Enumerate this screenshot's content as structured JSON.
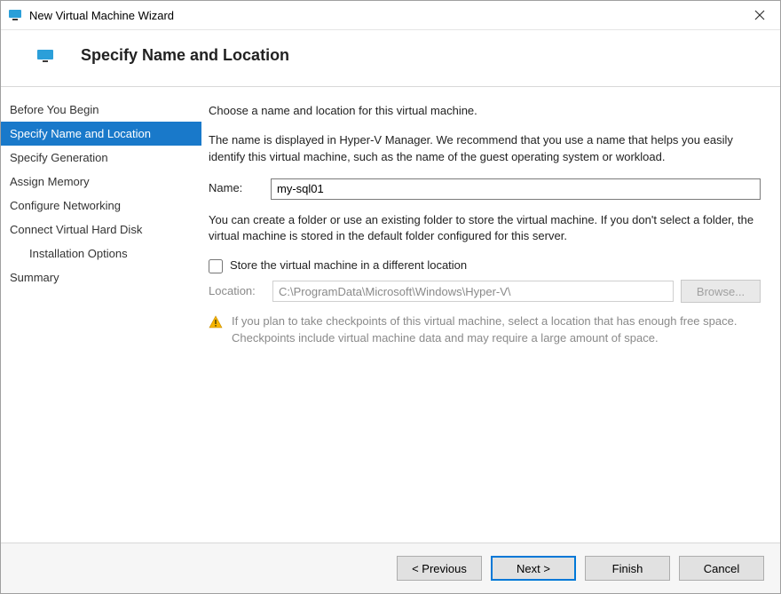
{
  "window": {
    "title": "New Virtual Machine Wizard"
  },
  "header": {
    "title": "Specify Name and Location"
  },
  "sidebar": {
    "items": [
      {
        "label": "Before You Begin",
        "active": false,
        "sub": false
      },
      {
        "label": "Specify Name and Location",
        "active": true,
        "sub": false
      },
      {
        "label": "Specify Generation",
        "active": false,
        "sub": false
      },
      {
        "label": "Assign Memory",
        "active": false,
        "sub": false
      },
      {
        "label": "Configure Networking",
        "active": false,
        "sub": false
      },
      {
        "label": "Connect Virtual Hard Disk",
        "active": false,
        "sub": false
      },
      {
        "label": "Installation Options",
        "active": false,
        "sub": true
      },
      {
        "label": "Summary",
        "active": false,
        "sub": false
      }
    ]
  },
  "content": {
    "intro": "Choose a name and location for this virtual machine.",
    "name_help": "The name is displayed in Hyper-V Manager. We recommend that you use a name that helps you easily identify this virtual machine, such as the name of the guest operating system or workload.",
    "name_label": "Name:",
    "name_value": "my-sql01",
    "folder_help": "You can create a folder or use an existing folder to store the virtual machine. If you don't select a folder, the virtual machine is stored in the default folder configured for this server.",
    "store_checkbox_label": "Store the virtual machine in a different location",
    "location_label": "Location:",
    "location_value": "C:\\ProgramData\\Microsoft\\Windows\\Hyper-V\\",
    "browse_label": "Browse...",
    "warning": "If you plan to take checkpoints of this virtual machine, select a location that has enough free space. Checkpoints include virtual machine data and may require a large amount of space."
  },
  "footer": {
    "previous": "< Previous",
    "next": "Next >",
    "finish": "Finish",
    "cancel": "Cancel"
  }
}
